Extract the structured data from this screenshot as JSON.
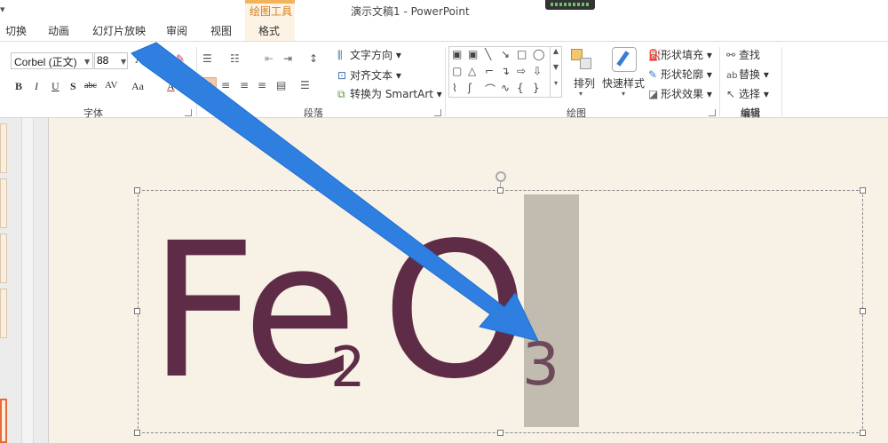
{
  "window": {
    "title": "演示文稿1 - PowerPoint",
    "contextual_tab_group": "绘图工具"
  },
  "tabs": [
    "切换",
    "动画",
    "幻灯片放映",
    "审阅",
    "视图",
    "格式"
  ],
  "font_group": {
    "label": "字体",
    "font_name": "Corbel (正文)",
    "font_size": "88",
    "bold": "B",
    "italic": "I",
    "underline": "U",
    "shadow": "S",
    "strikethrough": "abc",
    "char_spacing": "AV",
    "change_case": "Aa",
    "grow_font": "A",
    "font_color": "A"
  },
  "paragraph_group": {
    "label": "段落",
    "text_direction": "文字方向",
    "align_text": "对齐文本",
    "convert_smartart": "转换为 SmartArt"
  },
  "drawing_group": {
    "label": "绘图",
    "arrange": "排列",
    "quick_styles": "快速样式",
    "shape_fill": "形状填充",
    "shape_outline": "形状轮廓",
    "shape_effects": "形状效果"
  },
  "editing_group": {
    "label": "编辑",
    "find": "查找",
    "replace": "替换",
    "select": "选择"
  },
  "slide": {
    "formula_main_1": "Fe",
    "formula_sub_1": "2",
    "formula_main_2": "O",
    "formula_sub_2": "3"
  },
  "colors": {
    "slide_background": "#f8f1e6",
    "formula_text": "#5e2c46",
    "selection_highlight": "#c2bcb0",
    "annotation_arrow": "#2f7fe0",
    "contextual_tab": "#f3b35b"
  }
}
